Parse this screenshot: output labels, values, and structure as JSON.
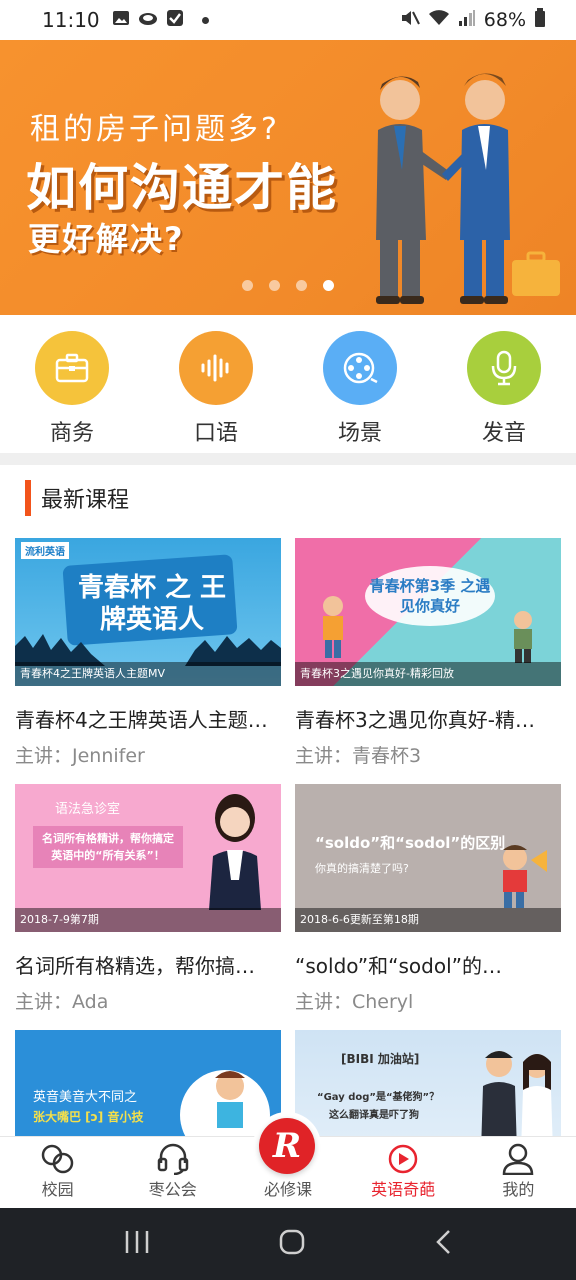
{
  "status_bar": {
    "time": "11:10",
    "battery": "68%"
  },
  "banner": {
    "line1": "租的房子问题多?",
    "line2": "如何沟通才能",
    "line3": "更好解决?",
    "slides": 4,
    "active_slide": 4
  },
  "categories": [
    {
      "label": "商务",
      "icon": "briefcase-icon",
      "color": "#f5c33b"
    },
    {
      "label": "口语",
      "icon": "soundwave-icon",
      "color": "#f5a033"
    },
    {
      "label": "场景",
      "icon": "film-reel-icon",
      "color": "#5aaef5"
    },
    {
      "label": "发音",
      "icon": "microphone-icon",
      "color": "#a8cf3d"
    }
  ],
  "section": {
    "title": "最新课程"
  },
  "courses": [
    {
      "thumb_caption": "青春杯4之王牌英语人主题MV",
      "title": "青春杯4之王牌英语人主题…",
      "speaker": "主讲：Jennifer",
      "thumb_text": "青春杯 之 王牌英语人",
      "thumb_badge": "流利英语"
    },
    {
      "thumb_caption": "青春杯3之遇见你真好-精彩回放",
      "title": "青春杯3之遇见你真好-精…",
      "speaker": "主讲：青春杯3",
      "thumb_text": "青春杯第3季 之遇见你真好"
    },
    {
      "thumb_caption": "2018-7-9第7期",
      "title": "名词所有格精选，帮你搞…",
      "speaker": "主讲：Ada",
      "thumb_text": "语法急诊室",
      "thumb_sub": "名词所有格精讲，帮你搞定英语中的“所有关系”！"
    },
    {
      "thumb_caption": "2018-6-6更新至第18期",
      "title": "“soldo”和“sodol”的…",
      "speaker": "主讲：Cheryl",
      "thumb_text": "“soldo”和“sodol”的区别",
      "thumb_sub": "你真的搞清楚了吗?"
    },
    {
      "thumb_text": "英音美音大不同之",
      "thumb_sub": "张大嘴巴 [ɔ] 音小技"
    },
    {
      "thumb_text": "[BIBI 加油站]",
      "thumb_sub": "“Gay dog”是“基佬狗”？",
      "thumb_sub2": "这么翻译真是吓了狗"
    }
  ],
  "bottom_nav": [
    {
      "label": "校园",
      "icon": "campus-icon"
    },
    {
      "label": "枣公会",
      "icon": "headset-icon"
    },
    {
      "label": "必修课",
      "icon": "r-logo-icon"
    },
    {
      "label": "英语奇葩",
      "icon": "play-circle-icon",
      "active": true
    },
    {
      "label": "我的",
      "icon": "user-icon"
    }
  ],
  "colors": {
    "accent": "#e8242f",
    "banner_bg": "#f28b2a",
    "section_bar": "#f2541b"
  }
}
